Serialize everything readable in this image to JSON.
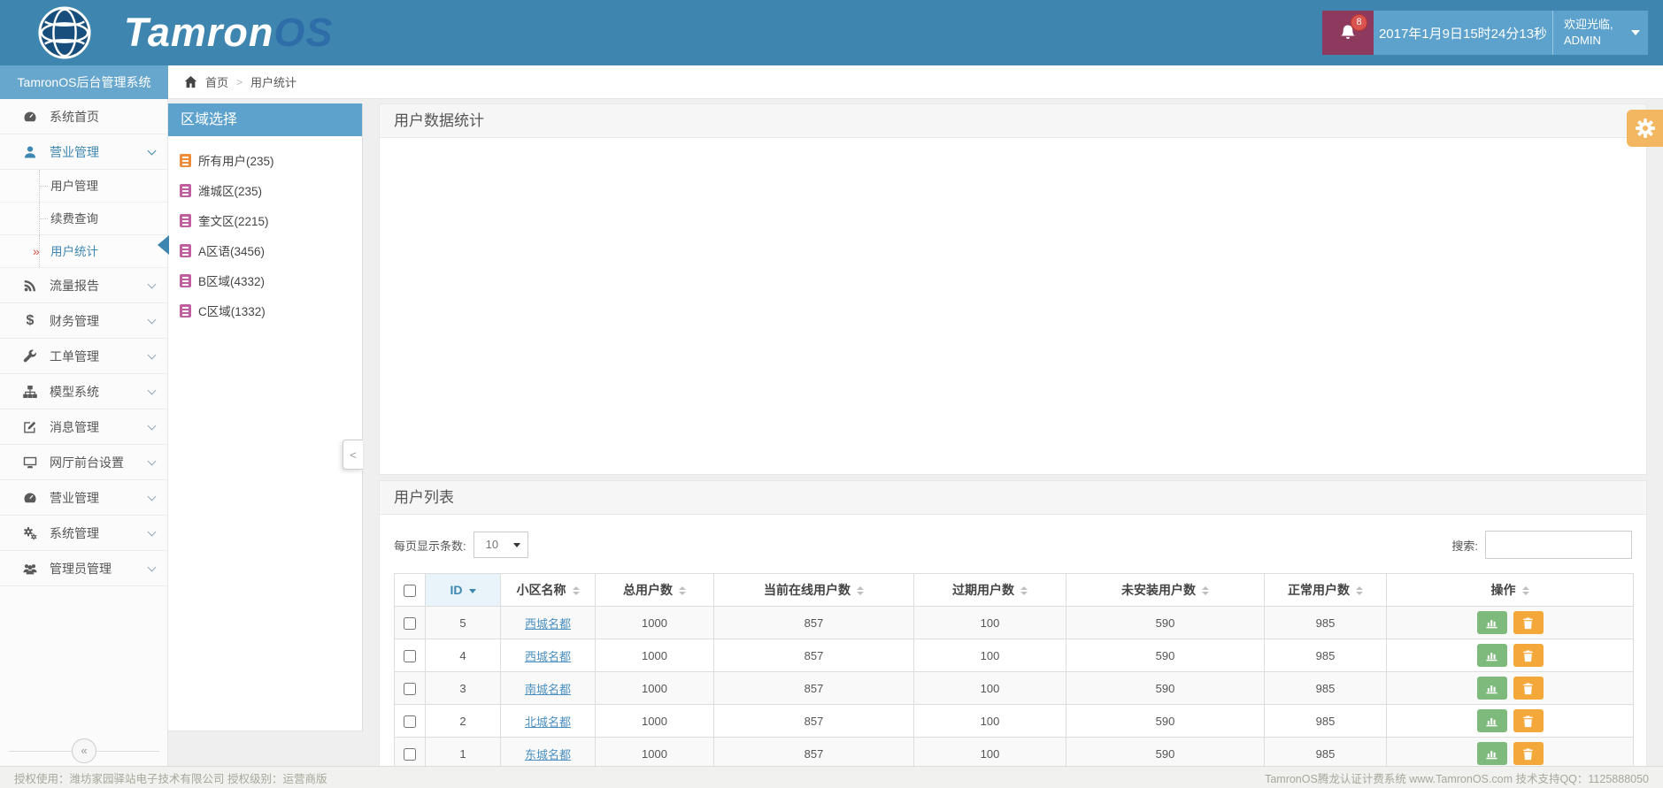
{
  "header": {
    "brand_primary": "Tamron",
    "brand_secondary": "OS",
    "notification_count": "8",
    "datetime": "2017年1月9日15时24分13秒",
    "welcome_line1": "欢迎光临,",
    "welcome_line2": "ADMIN"
  },
  "sidebar": {
    "title": "TamronOS后台管理系统",
    "items": [
      {
        "label": "系统首页",
        "icon": "dashboard-icon"
      },
      {
        "label": "营业管理",
        "icon": "user-icon"
      },
      {
        "label": "流量报告",
        "icon": "rss-icon"
      },
      {
        "label": "财务管理",
        "icon": "dollar-icon"
      },
      {
        "label": "工单管理",
        "icon": "wrench-icon"
      },
      {
        "label": "模型系统",
        "icon": "sitemap-icon"
      },
      {
        "label": "消息管理",
        "icon": "edit-icon"
      },
      {
        "label": "网厅前台设置",
        "icon": "desktop-icon"
      },
      {
        "label": "营业管理",
        "icon": "dashboard-icon"
      },
      {
        "label": "系统管理",
        "icon": "gears-icon"
      },
      {
        "label": "管理员管理",
        "icon": "users-icon"
      }
    ],
    "submenu": [
      {
        "label": "用户管理"
      },
      {
        "label": "续费查询"
      },
      {
        "label": "用户统计"
      }
    ],
    "collapse_glyph": "«"
  },
  "breadcrumb": {
    "home": "首页",
    "current": "用户统计"
  },
  "region_panel": {
    "title": "区域选择",
    "items": [
      {
        "label": "所有用户(235)",
        "icon": "building-icon",
        "color": "#ef8c3c"
      },
      {
        "label": "潍城区(235)",
        "icon": "building-icon",
        "color": "#c05fa0"
      },
      {
        "label": "奎文区(2215)",
        "icon": "building-icon",
        "color": "#c05fa0"
      },
      {
        "label": "A区语(3456)",
        "icon": "building-icon",
        "color": "#c05fa0"
      },
      {
        "label": "B区域(4332)",
        "icon": "building-icon",
        "color": "#c05fa0"
      },
      {
        "label": "C区域(1332)",
        "icon": "building-icon",
        "color": "#c05fa0"
      }
    ],
    "collapse_glyph": "<"
  },
  "main": {
    "stats_panel_title": "用户数据统计",
    "list_panel_title": "用户列表",
    "per_page_label": "每页显示条数:",
    "per_page_value": "10",
    "search_label": "搜索:",
    "table": {
      "headers": [
        "ID",
        "小区名称",
        "总用户数",
        "当前在线用户数",
        "过期用户数",
        "未安装用户数",
        "正常用户数",
        "操作"
      ],
      "rows": [
        {
          "id": "5",
          "name": "西城名都",
          "total": "1000",
          "online": "857",
          "expired": "100",
          "uninstalled": "590",
          "normal": "985"
        },
        {
          "id": "4",
          "name": "西城名都",
          "total": "1000",
          "online": "857",
          "expired": "100",
          "uninstalled": "590",
          "normal": "985"
        },
        {
          "id": "3",
          "name": "南城名都",
          "total": "1000",
          "online": "857",
          "expired": "100",
          "uninstalled": "590",
          "normal": "985"
        },
        {
          "id": "2",
          "name": "北城名都",
          "total": "1000",
          "online": "857",
          "expired": "100",
          "uninstalled": "590",
          "normal": "985"
        },
        {
          "id": "1",
          "name": "东城名都",
          "total": "1000",
          "online": "857",
          "expired": "100",
          "uninstalled": "590",
          "normal": "985"
        }
      ]
    }
  },
  "footer": {
    "left": "授权使用：潍坊家园驿站电子技术有限公司  授权级别：运营商版",
    "right": "TamronOS腾龙认证计费系统 www.TamronOS.com 技术支持QQ：1125888050"
  },
  "colors": {
    "header_blue": "#3e86af",
    "light_blue": "#5ca2cc",
    "accent_blue": "#3e87b0",
    "bell_maroon": "#8e3a5f",
    "badge_red": "#d9534f",
    "button_green": "#7eba7c",
    "button_orange": "#f4a839",
    "gear_orange": "#f3b661",
    "link_blue": "#4a8fc0",
    "region_icon_orange": "#ef8c3c",
    "region_icon_pink": "#c05fa0"
  }
}
